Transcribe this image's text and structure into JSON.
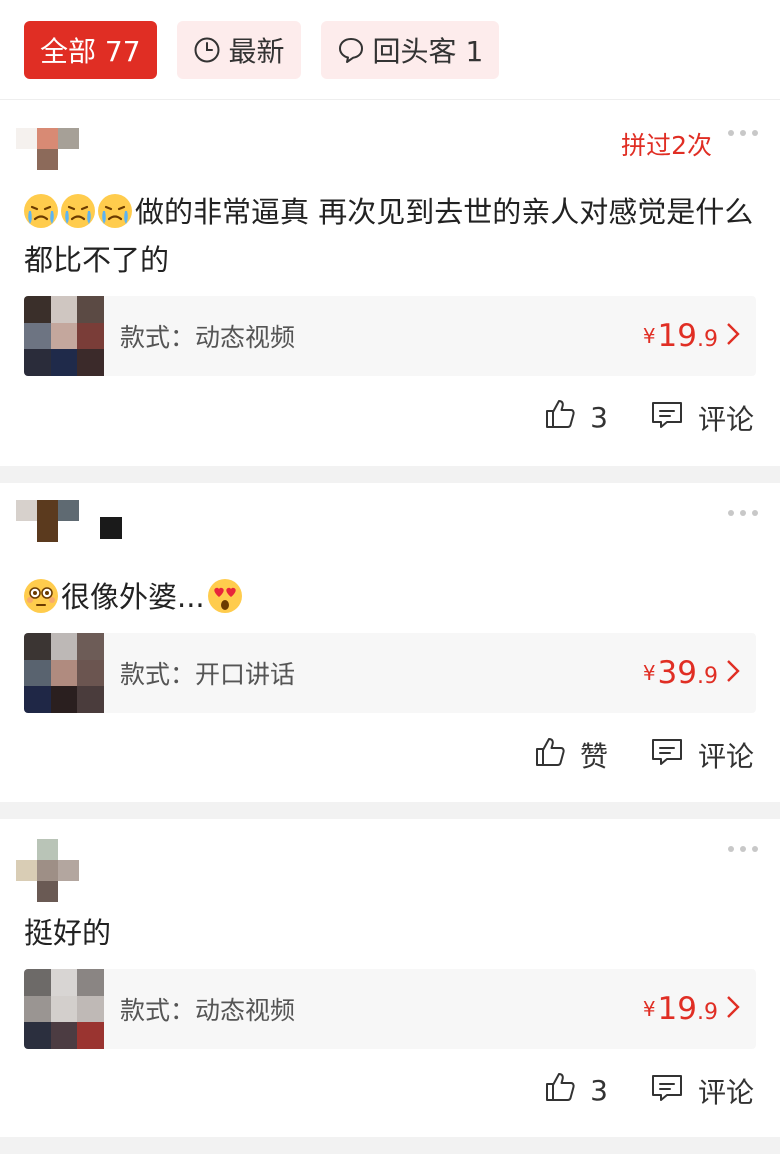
{
  "filters": [
    {
      "label": "全部 77",
      "active": true
    },
    {
      "label": "最新",
      "icon": "clock-icon",
      "active": false
    },
    {
      "label": "回头客 1",
      "icon": "chat-bubble-icon",
      "active": false
    }
  ],
  "reviews": [
    {
      "repeat_badge": "拼过2次",
      "text": "做的非常逼真 再次见到去世的亲人对感觉是什么都比不了的",
      "emojis": [
        "crying-emoji",
        "crying-emoji",
        "crying-emoji"
      ],
      "product": {
        "style": "款式：动态视频",
        "yen": "¥",
        "price_int": "19",
        "price_dec": ".9"
      },
      "likes": "3",
      "comment_label": "评论"
    },
    {
      "repeat_badge": "",
      "text": "很像外婆...",
      "emojis": [
        "flushed-emoji",
        "heart-eyes-emoji"
      ],
      "product": {
        "style": "款式：开口讲话",
        "yen": "¥",
        "price_int": "39",
        "price_dec": ".9"
      },
      "likes": "赞",
      "comment_label": "评论"
    },
    {
      "repeat_badge": "",
      "text": "挺好的",
      "emojis": [],
      "product": {
        "style": "款式：动态视频",
        "yen": "¥",
        "price_int": "19",
        "price_dec": ".9"
      },
      "likes": "3",
      "comment_label": "评论"
    }
  ],
  "colors": {
    "accent": "#e02e24",
    "chip_bg": "#fdecec",
    "divider": "#f2f2f2"
  }
}
